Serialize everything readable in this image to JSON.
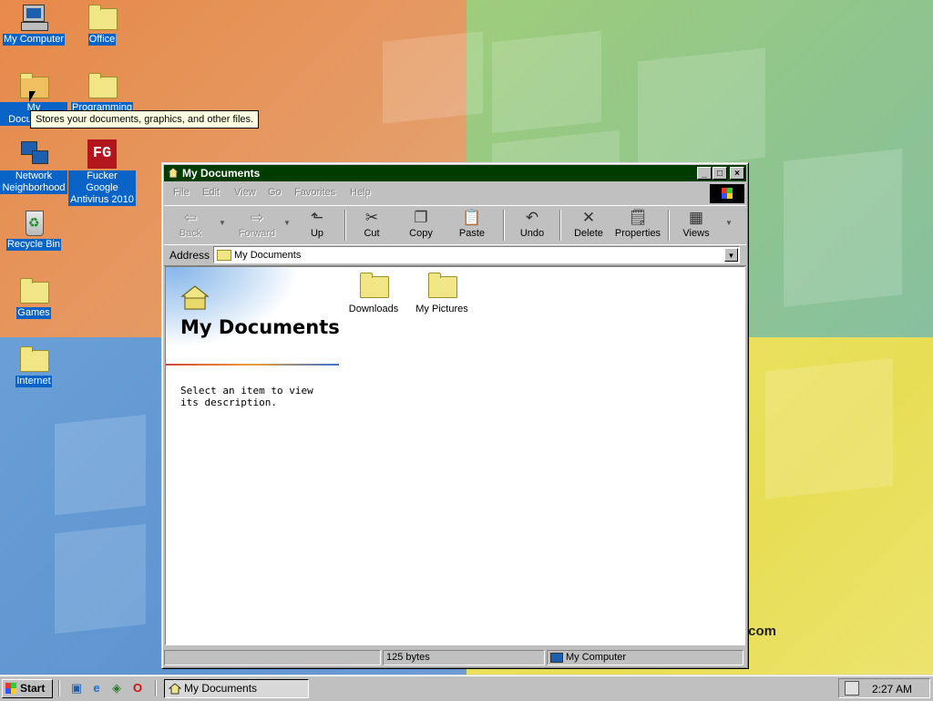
{
  "desktop": {
    "icons": [
      {
        "label": "My Computer"
      },
      {
        "label": "Office"
      },
      {
        "label": "My Documents"
      },
      {
        "label": "Programming"
      },
      {
        "label": "Network Neighborhood"
      },
      {
        "label": "Fucker Google Antivirus 2010"
      },
      {
        "label": "Recycle Bin"
      },
      {
        "label": "Games"
      },
      {
        "label": "Internet"
      }
    ],
    "tooltip": "Stores your documents, graphics, and other files.",
    "watermark": "t.com"
  },
  "window": {
    "title": "My Documents",
    "controls": {
      "minimize": "_",
      "maximize": "□",
      "close": "×"
    },
    "menu": [
      "File",
      "Edit",
      "View",
      "Go",
      "Favorites",
      "Help"
    ],
    "toolbar": {
      "back": "Back",
      "forward": "Forward",
      "up": "Up",
      "cut": "Cut",
      "copy": "Copy",
      "paste": "Paste",
      "undo": "Undo",
      "delete": "Delete",
      "properties": "Properties",
      "views": "Views"
    },
    "address": {
      "label": "Address",
      "value": "My Documents"
    },
    "webview": {
      "title": "My Documents",
      "description": "Select an item to view its description."
    },
    "files": [
      {
        "name": "Downloads",
        "icon": "folder-icon"
      },
      {
        "name": "My Pictures",
        "icon": "folder-icon"
      }
    ],
    "status": {
      "size": "125 bytes",
      "zone": "My Computer"
    }
  },
  "taskbar": {
    "start_label": "Start",
    "quicklaunch": [
      "desktop-icon",
      "internet-explorer-icon",
      "channels-icon",
      "opera-icon"
    ],
    "task": "My Documents",
    "clock": "2:27 AM"
  },
  "colors": {
    "titlebar": "#003c00",
    "selection": "#0a64c8",
    "tooltip": "#ffffe1"
  }
}
